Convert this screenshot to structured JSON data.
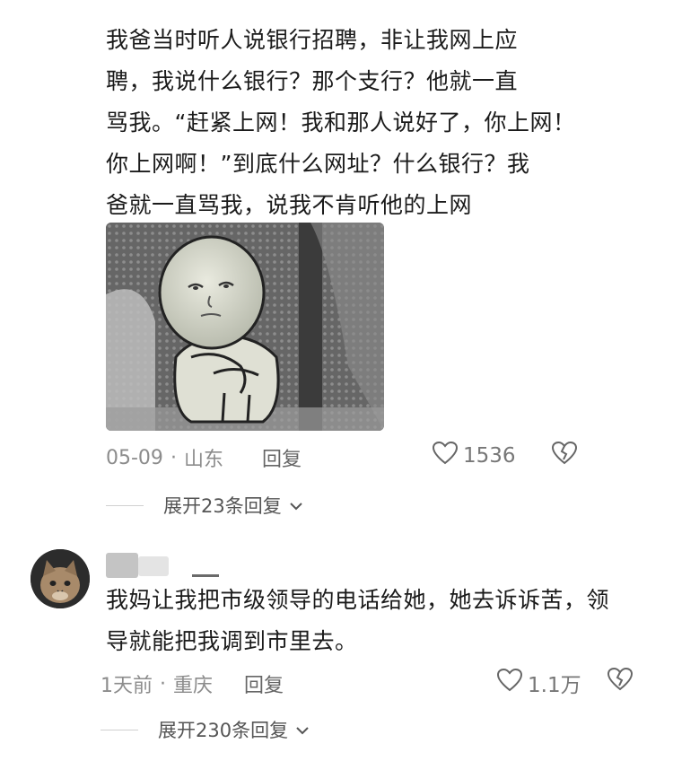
{
  "comment1": {
    "lines": [
      "我爸当时听人说银行招聘，非让我网上应",
      "聘，我说什么银行？那个支行？他就一直",
      "骂我。“赶紧上网！我和那人说好了，你上网！",
      "你上网啊！”到底什么网址？什么银行？我",
      "爸就一直骂我，说我不肯听他的上网"
    ],
    "date": "05-09",
    "location": "山东",
    "reply_label": "回复",
    "like_count": "1536",
    "expand_label": "展开23条回复"
  },
  "comment2": {
    "lines": [
      "我妈让我把市级领导的电话给她，她去诉诉苦，领",
      "导就能把我调到市里去。"
    ],
    "time": "1天前",
    "location": "重庆",
    "reply_label": "回复",
    "like_count": "1.1万",
    "expand_label": "展开230条回复"
  },
  "separator": "·",
  "icons": {
    "like": "heart-outline-icon",
    "dislike": "broken-heart-icon",
    "expand": "chevron-down-icon"
  },
  "colors": {
    "text": "#1b1b1b",
    "meta": "#8c8c8c"
  }
}
